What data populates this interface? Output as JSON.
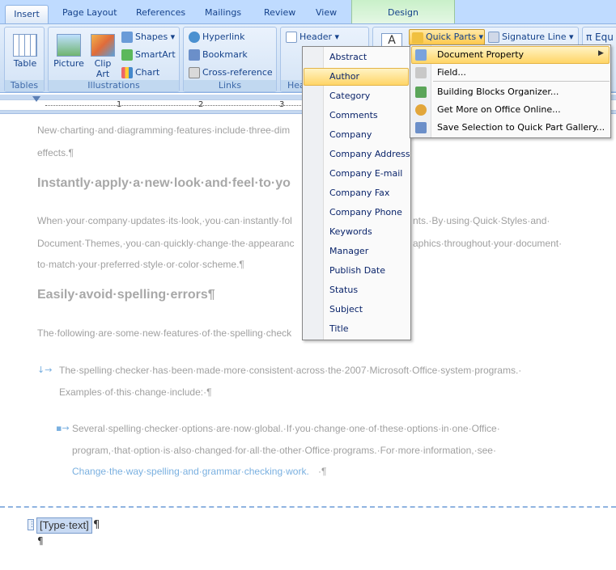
{
  "tabs": {
    "insert": "Insert",
    "page_layout": "Page Layout",
    "references": "References",
    "mailings": "Mailings",
    "review": "Review",
    "view": "View",
    "design": "Design"
  },
  "ribbon": {
    "tables": {
      "table": "Table",
      "group": "Tables"
    },
    "illustrations": {
      "picture": "Picture",
      "clip_art": "Clip Art",
      "shapes": "Shapes",
      "smartart": "SmartArt",
      "chart": "Chart",
      "group": "Illustrations"
    },
    "links": {
      "hyperlink": "Hyperlink",
      "bookmark": "Bookmark",
      "cross_reference": "Cross-reference",
      "group": "Links"
    },
    "header_footer": {
      "header": "Header",
      "group": "Hea"
    },
    "text": {
      "quick_parts": "Quick Parts",
      "signature_line": "Signature Line",
      "equation": "π Equ"
    }
  },
  "quick_parts_menu": {
    "items": [
      "Document Property",
      "Field...",
      "Building Blocks Organizer...",
      "Get More on Office Online...",
      "Save Selection to Quick Part Gallery..."
    ]
  },
  "property_menu": {
    "items": [
      "Abstract",
      "Author",
      "Category",
      "Comments",
      "Company",
      "Company Address",
      "Company E-mail",
      "Company Fax",
      "Company Phone",
      "Keywords",
      "Manager",
      "Publish Date",
      "Status",
      "Subject",
      "Title"
    ],
    "selected": "Author"
  },
  "document": {
    "p1": "New·charting·and·diagramming·features·include·three-dim",
    "p1b": "effects.¶",
    "h1": "Instantly·apply·a·new·look·and·feel·to·yo",
    "p2a": "When·your·company·updates·its·look,·you·can·instantly·fol",
    "p2a_end": "nts.·By·using·Quick·Styles·and·",
    "p2b": "Document·Themes,·you·can·quickly·change·the·appearanc",
    "p2b_end": "aphics·throughout·your·document·",
    "p2c": "to·match·your·preferred·style·or·color·scheme.¶",
    "h2": "Easily·avoid·spelling·errors¶",
    "p3": "The·following·are·some·new·features·of·the·spelling·check",
    "b1a": "The·spelling·checker·has·been·made·more·consistent·across·the·2007·Microsoft·Office·system·programs.·",
    "b1b": "Examples·of·this·change·include:·¶",
    "b2a": "Several·spelling·checker·options·are·now·global.·If·you·change·one·of·these·options·in·one·Office·",
    "b2b": "program,·that·option·is·also·changed·for·all·the·other·Office·programs.·For·more·information,·see·",
    "b2c_link": "Change·the·way·spelling·and·grammar·checking·work.",
    "b2c_end": "·¶",
    "placeholder": "[Type·text]",
    "pilcrow": "¶"
  },
  "ruler": {
    "marks": [
      "1",
      "2",
      "3"
    ]
  },
  "colors": {
    "ribbon_text": "#15428b",
    "highlight": "#ffd567",
    "tab_bg": "#bfdbff"
  }
}
